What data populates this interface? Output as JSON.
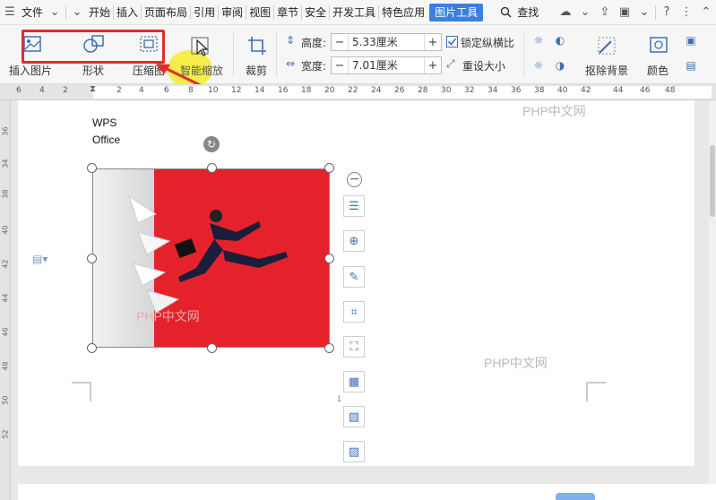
{
  "menubar": {
    "file": "文件",
    "tabs": [
      "开始",
      "插入",
      "页面布局",
      "引用",
      "审阅",
      "视图",
      "章节",
      "安全",
      "开发工具",
      "特色应用"
    ],
    "active_tab": "图片工具",
    "search": "查找"
  },
  "ribbon": {
    "insert_picture": "插入图片",
    "shape": "形状",
    "compress": "压缩图",
    "smart_zoom": "智能缩放",
    "crop": "裁剪",
    "height_label": "高度:",
    "height_value": "5.33厘米",
    "width_label": "宽度:",
    "width_value": "7.01厘米",
    "lock_ratio": "锁定纵横比",
    "lock_checked": true,
    "reset_size": "重设大小",
    "remove_bg": "抠除背景",
    "color": "颜色"
  },
  "ruler": {
    "ticks": [
      "6",
      "4",
      "2",
      "2",
      "4",
      "6",
      "8",
      "10",
      "12",
      "14",
      "16",
      "18",
      "20",
      "22",
      "24",
      "26",
      "28",
      "30",
      "32",
      "34",
      "36",
      "38",
      "40",
      "42",
      "44",
      "46",
      "48"
    ]
  },
  "vruler": {
    "ticks": [
      "36",
      "34",
      "38",
      "40",
      "42",
      "44",
      "46",
      "48",
      "50",
      "52"
    ]
  },
  "document": {
    "line1": "WPS",
    "line2": "Office",
    "page_marker": "1"
  },
  "watermarks": [
    "PHP中文网",
    "PHP中文网",
    "PHP中文网"
  ],
  "colors": {
    "active_tab": "#3b7fe0",
    "highlight": "#e22b2b",
    "picture_bg": "#e5222c",
    "icon": "#3d6fb5"
  }
}
